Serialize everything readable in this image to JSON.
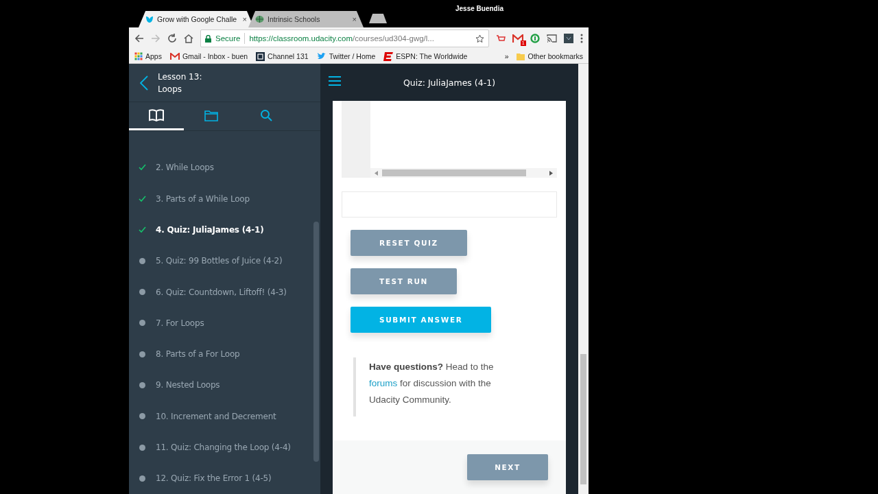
{
  "profile_name": "Jesse Buendia",
  "tabs": [
    {
      "title": "Grow with Google Challe",
      "close": "×",
      "selected": true
    },
    {
      "title": "Intrinsic Schools",
      "close": "×",
      "selected": false
    }
  ],
  "address_bar": {
    "security": "Secure",
    "url_host": "https://classroom.udacity.com",
    "url_path": "/courses/ud304-gwg/l..."
  },
  "extension_badge": "1",
  "bookmarks": [
    {
      "label": "Apps",
      "kind": "apps"
    },
    {
      "label": "Gmail - Inbox - buen",
      "kind": "gmail"
    },
    {
      "label": "Channel 131",
      "kind": "na"
    },
    {
      "label": "Twitter / Home",
      "kind": "twitter"
    },
    {
      "label": "ESPN: The Worldwide",
      "kind": "espn"
    }
  ],
  "bookmarks_more": "»",
  "other_bookmarks": "Other bookmarks",
  "lesson": {
    "line1": "Lesson 13:",
    "line2": "Loops"
  },
  "sidebar_tabs": [
    {
      "kind": "book",
      "selected": true
    },
    {
      "kind": "folder",
      "selected": false
    },
    {
      "kind": "search",
      "selected": false
    }
  ],
  "concepts": [
    {
      "label": "2. While Loops",
      "done": true,
      "selected": false
    },
    {
      "label": "3. Parts of a While Loop",
      "done": true,
      "selected": false
    },
    {
      "label": "4. Quiz: JuliaJames (4-1)",
      "done": true,
      "selected": true
    },
    {
      "label": "5. Quiz: 99 Bottles of Juice (4-2)",
      "done": false,
      "selected": false
    },
    {
      "label": "6. Quiz: Countdown, Liftoff! (4-3)",
      "done": false,
      "selected": false
    },
    {
      "label": "7. For Loops",
      "done": false,
      "selected": false
    },
    {
      "label": "8. Parts of a For Loop",
      "done": false,
      "selected": false
    },
    {
      "label": "9. Nested Loops",
      "done": false,
      "selected": false
    },
    {
      "label": "10. Increment and Decrement",
      "done": false,
      "selected": false
    },
    {
      "label": "11. Quiz: Changing the Loop (4-4)",
      "done": false,
      "selected": false
    },
    {
      "label": "12. Quiz: Fix the Error 1 (4-5)",
      "done": false,
      "selected": false
    }
  ],
  "page_title": "Quiz: JuliaJames (4-1)",
  "quiz_buttons": [
    {
      "label": "RESET QUIZ",
      "kind": "secondary"
    },
    {
      "label": "TEST RUN",
      "kind": "secondary"
    },
    {
      "label": "SUBMIT ANSWER",
      "kind": "primary"
    }
  ],
  "help": {
    "bold": "Have questions?",
    "before_link": "Head to the",
    "link": "forums",
    "after_link": "for discussion with the Udacity Community."
  },
  "next_button": "NEXT"
}
